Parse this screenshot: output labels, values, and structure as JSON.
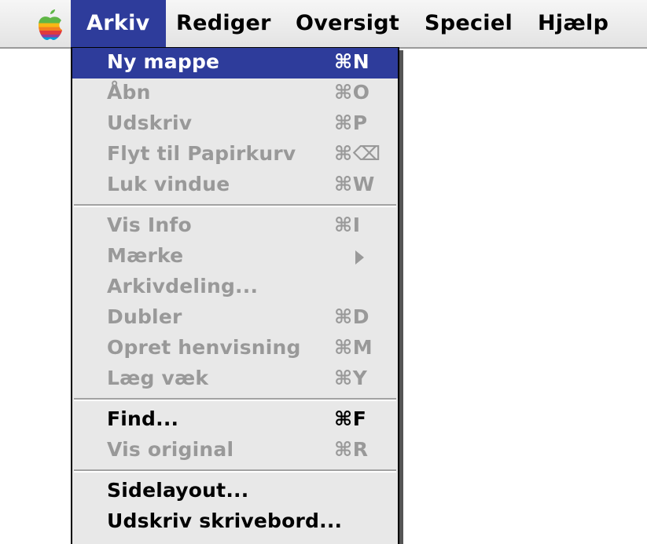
{
  "menubar": {
    "apple_icon": "apple-logo-icon",
    "items": [
      {
        "label": "Arkiv",
        "active": true
      },
      {
        "label": "Rediger"
      },
      {
        "label": "Oversigt"
      },
      {
        "label": "Speciel"
      },
      {
        "label": "Hjælp"
      }
    ]
  },
  "menu": {
    "items": [
      {
        "label": "Ny mappe",
        "shortcut": "⌘N",
        "enabled": true,
        "selected": true
      },
      {
        "label": "Åbn",
        "shortcut": "⌘O",
        "enabled": false
      },
      {
        "label": "Udskriv",
        "shortcut": "⌘P",
        "enabled": false
      },
      {
        "label": "Flyt til Papirkurv",
        "shortcut": "⌘⌫",
        "enabled": false
      },
      {
        "label": "Luk vindue",
        "shortcut": "⌘W",
        "enabled": false
      },
      {
        "label": "Vis Info",
        "shortcut": "⌘I",
        "enabled": false
      },
      {
        "label": "Mærke",
        "shortcut": "",
        "submenu": true,
        "enabled": false
      },
      {
        "label": "Arkivdeling...",
        "shortcut": "",
        "enabled": false
      },
      {
        "label": "Dubler",
        "shortcut": "⌘D",
        "enabled": false
      },
      {
        "label": "Opret henvisning",
        "shortcut": "⌘M",
        "enabled": false
      },
      {
        "label": "Læg væk",
        "shortcut": "⌘Y",
        "enabled": false
      },
      {
        "label": "Find...",
        "shortcut": "⌘F",
        "enabled": true
      },
      {
        "label": "Vis original",
        "shortcut": "⌘R",
        "enabled": false
      },
      {
        "label": "Sidelayout...",
        "shortcut": "",
        "enabled": true
      },
      {
        "label": "Udskriv skrivebord...",
        "shortcut": "",
        "enabled": true
      }
    ]
  },
  "colors": {
    "highlight": "#2e3c9b",
    "menu_bg": "#e8e8e8",
    "disabled_text": "#999999"
  }
}
